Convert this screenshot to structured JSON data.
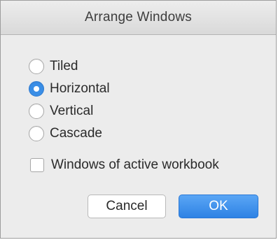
{
  "dialog": {
    "title": "Arrange Windows"
  },
  "options": [
    {
      "label": "Tiled",
      "selected": false
    },
    {
      "label": "Horizontal",
      "selected": true
    },
    {
      "label": "Vertical",
      "selected": false
    },
    {
      "label": "Cascade",
      "selected": false
    }
  ],
  "active_workbook": {
    "label": "Windows of active workbook",
    "checked": false
  },
  "buttons": {
    "cancel": "Cancel",
    "ok": "OK"
  },
  "colors": {
    "accent": "#3a8ee6",
    "background": "#ececec"
  }
}
